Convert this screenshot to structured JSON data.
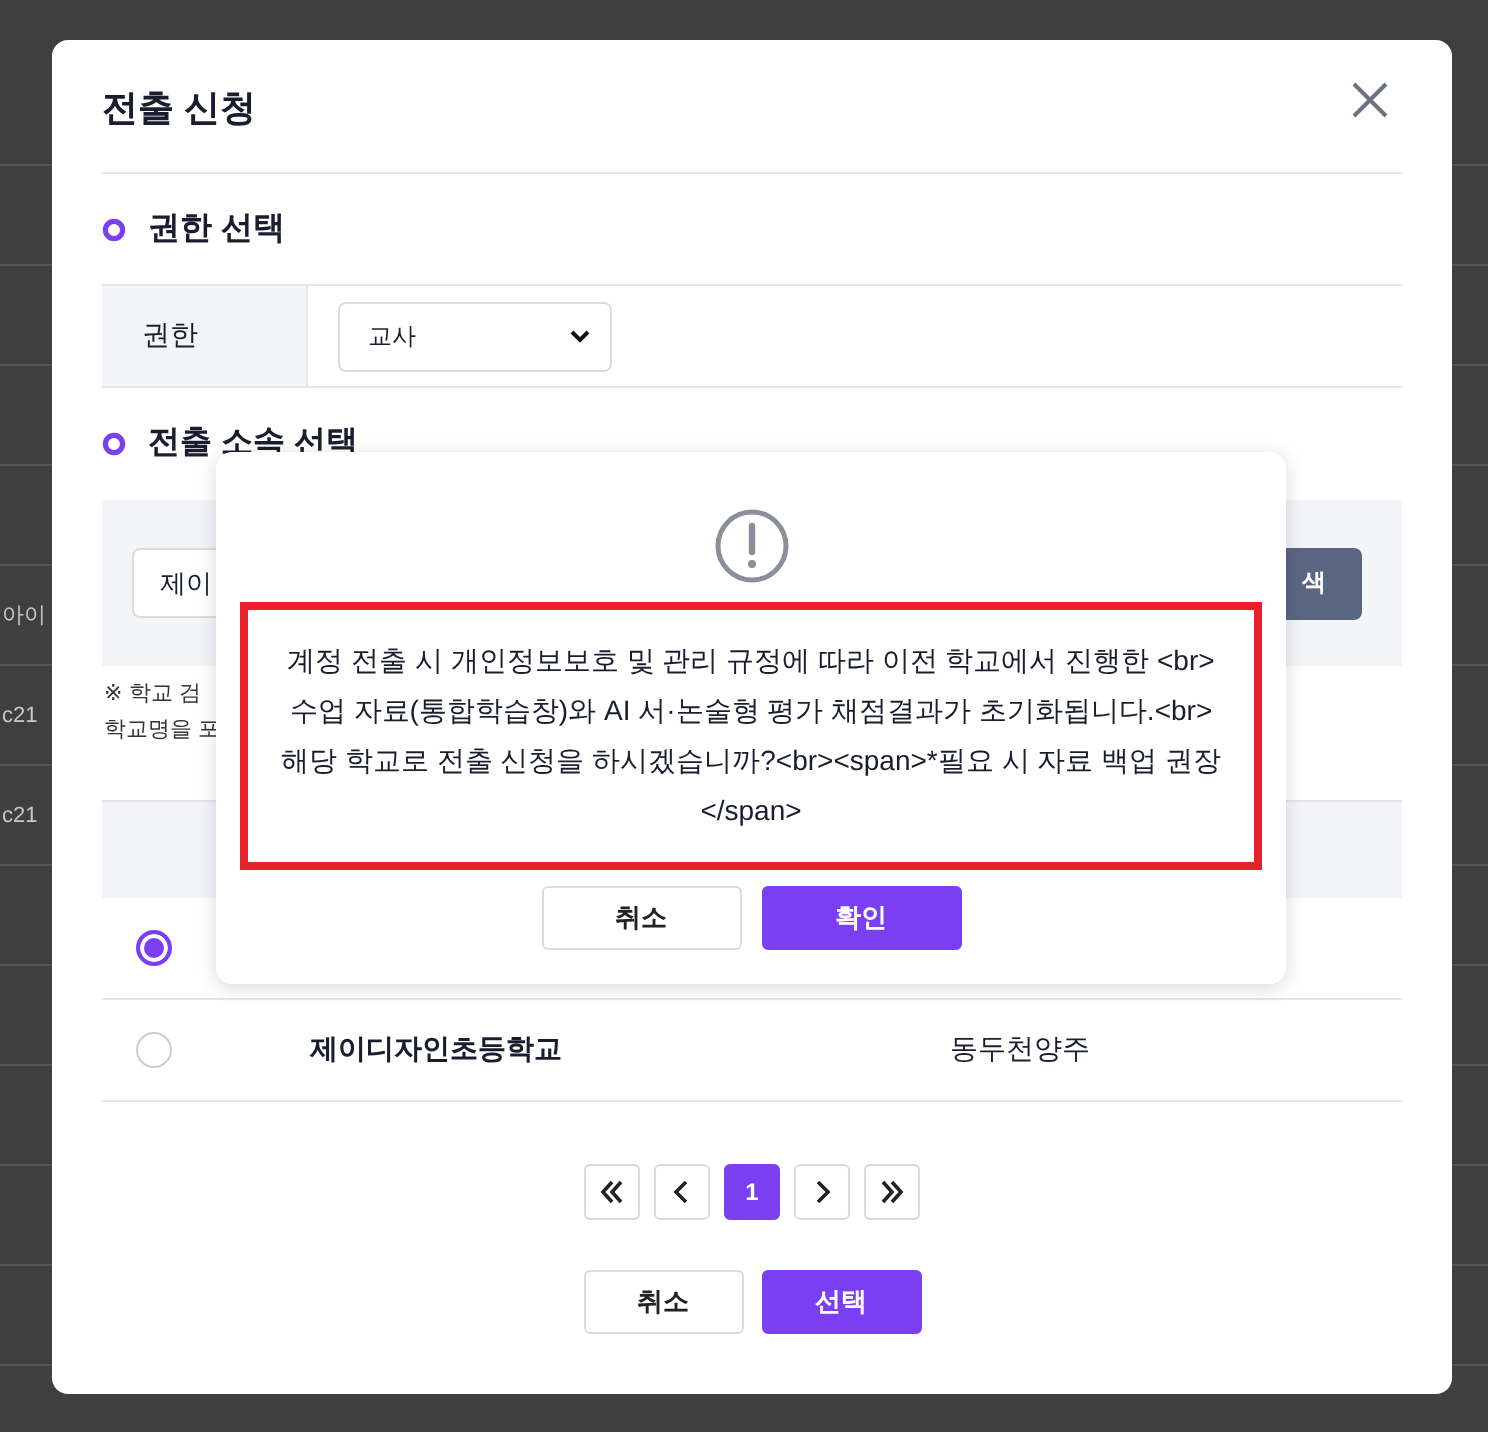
{
  "background_page": {
    "rows": [
      {
        "text": ""
      },
      {
        "text": ""
      },
      {
        "text": ""
      },
      {
        "text": ""
      },
      {
        "text": ""
      },
      {
        "text": "아이"
      },
      {
        "text": "c21"
      },
      {
        "text": "c21"
      },
      {
        "text": ""
      },
      {
        "text": ""
      },
      {
        "text": ""
      },
      {
        "text": ""
      },
      {
        "text": ""
      },
      {
        "text": ""
      }
    ]
  },
  "dialog": {
    "title": "전출 신청",
    "sections": [
      "권한 선택",
      "전출 소속 선택"
    ],
    "permission": {
      "label": "권한",
      "value": "교사"
    },
    "search": {
      "value": "제이",
      "button": "색",
      "notes": [
        "※ 학교 검",
        "학교명을 포"
      ]
    },
    "table": {
      "rows": [
        {
          "selected": true,
          "school": "",
          "region": ""
        },
        {
          "selected": false,
          "school": "제이디자인초등학교",
          "region": "동두천양주"
        }
      ]
    },
    "pagination": {
      "pages": [
        {
          "label": "1",
          "selected": true
        }
      ]
    },
    "buttons": [
      {
        "label": "취소",
        "kind": "secondary"
      },
      {
        "label": "선택",
        "kind": "primary"
      }
    ]
  },
  "alert": {
    "message": "계정 전출 시 개인정보보호 및 관리 규정에 따라 이전 학교에서 진행한 <br>수업 자료(통합학습창)와 AI 서·논술형 평가 채점결과가 초기화됩니다.<br>해당 학교로 전출 신청을 하시겠습니까?<br><span>*필요 시 자료 백업 권장</span>",
    "highlighted": true,
    "buttons": [
      {
        "label": "취소",
        "kind": "secondary"
      },
      {
        "label": "확인",
        "kind": "primary"
      }
    ]
  }
}
